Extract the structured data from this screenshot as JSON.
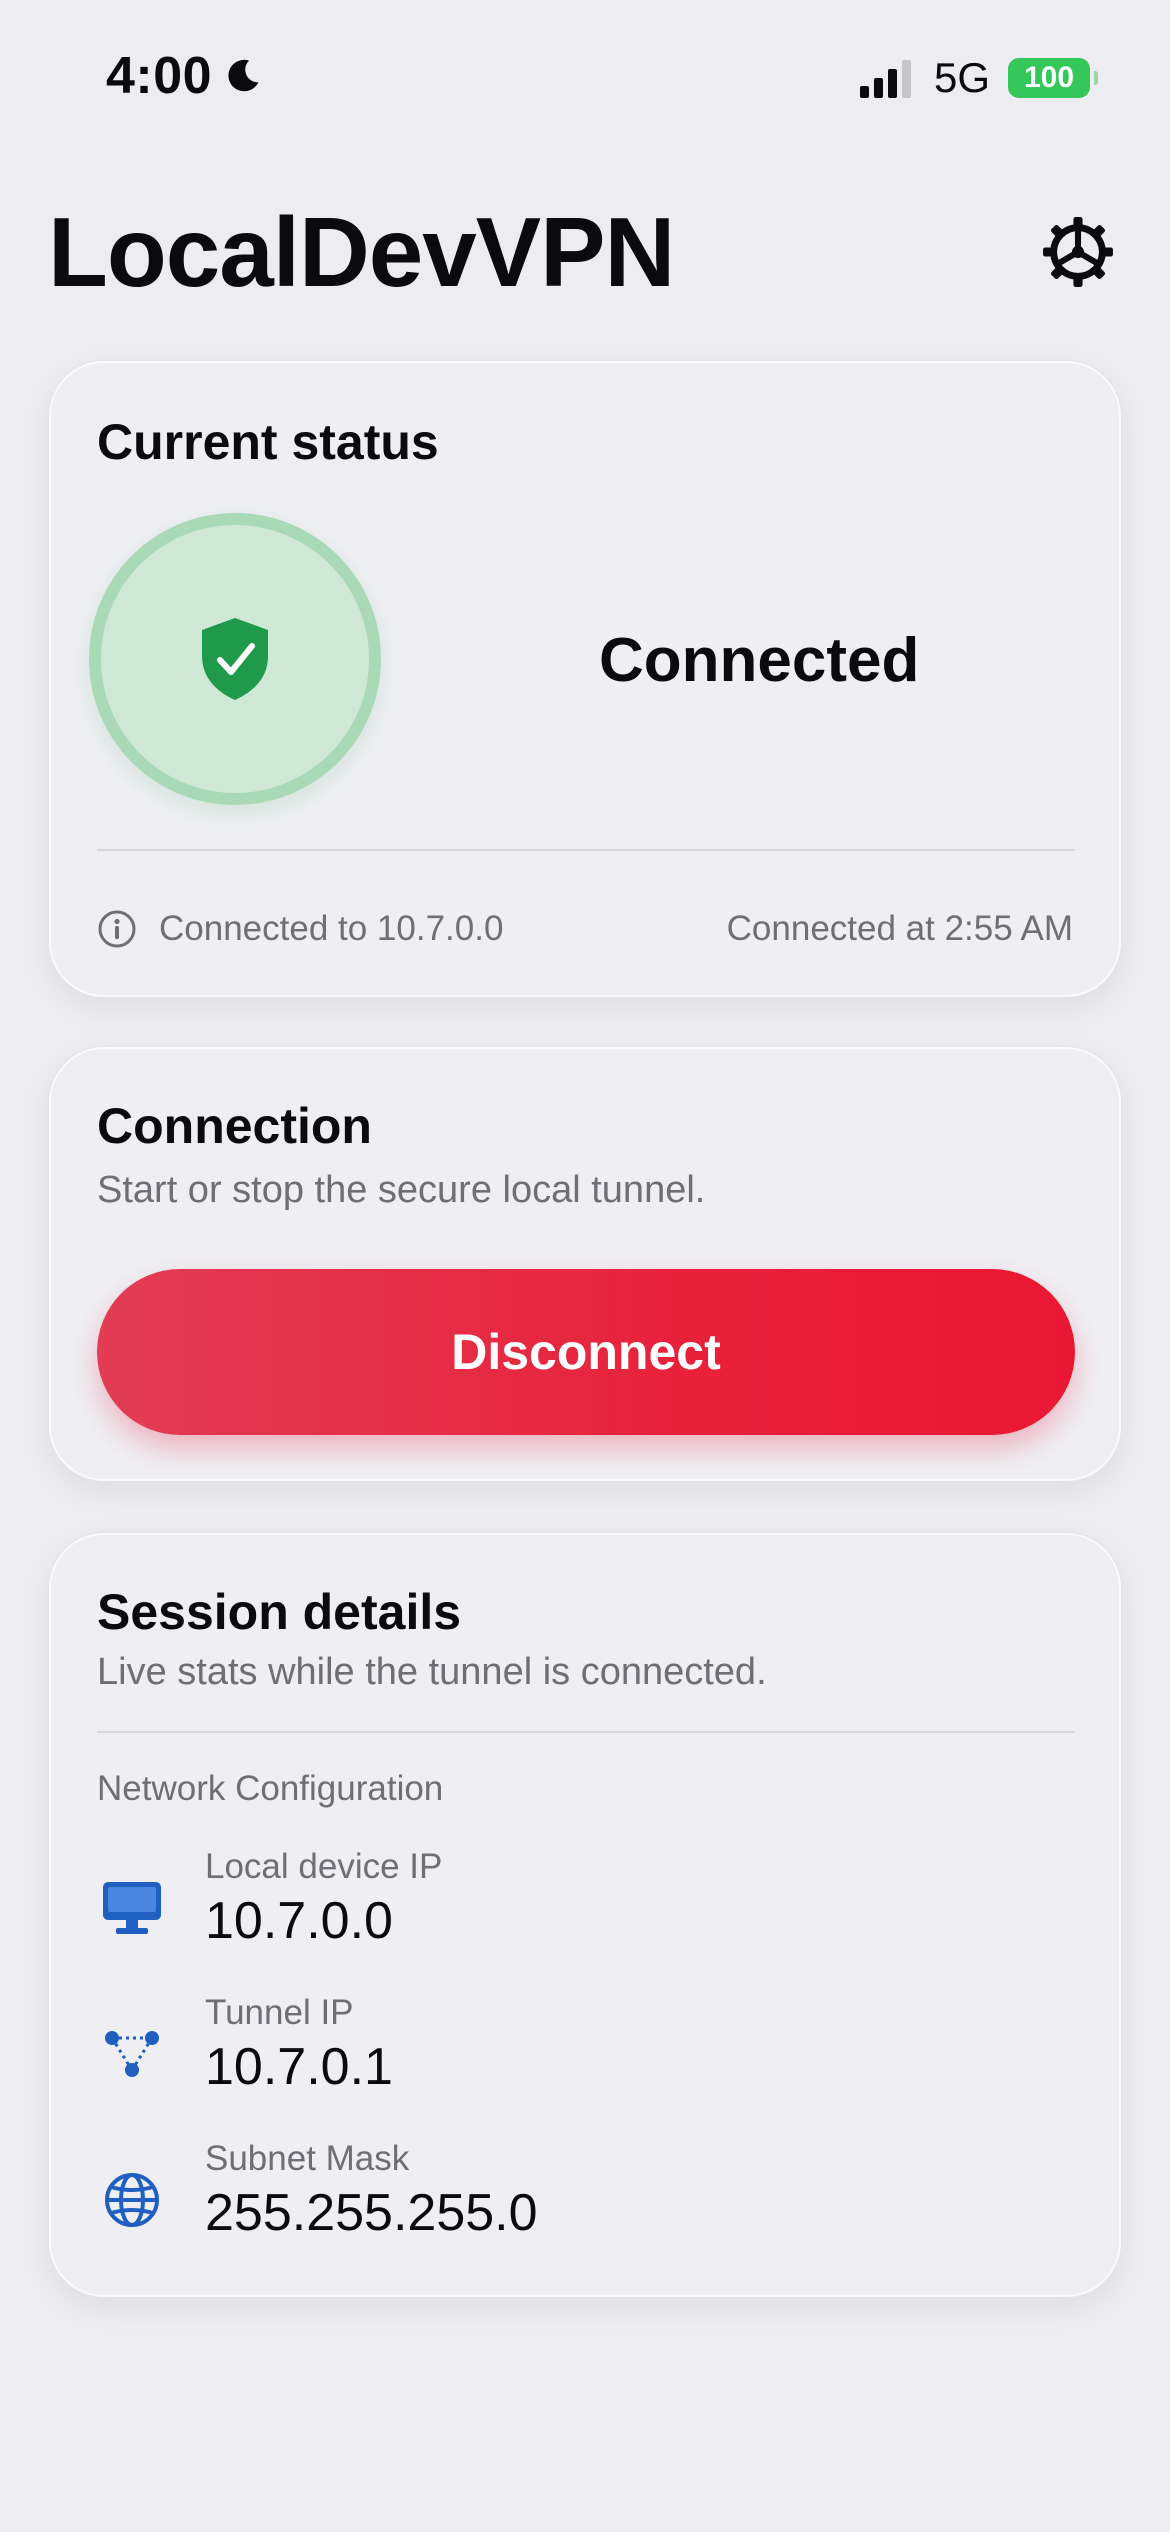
{
  "status_bar": {
    "time": "4:00",
    "network": "5G",
    "battery": "100"
  },
  "header": {
    "title": "LocalDevVPN"
  },
  "status_card": {
    "title": "Current status",
    "state": "Connected",
    "connected_to": "Connected to 10.7.0.0",
    "connected_at": "Connected at 2:55 AM",
    "accent_color": "#1e9a4a"
  },
  "connection_card": {
    "title": "Connection",
    "subtitle": "Start or stop the secure local tunnel.",
    "button_label": "Disconnect",
    "button_color": "#e8213b"
  },
  "session_card": {
    "title": "Session details",
    "subtitle": "Live stats while the tunnel is connected.",
    "section_label": "Network Configuration",
    "items": [
      {
        "icon": "desktop-computer-icon",
        "label": "Local device IP",
        "value": "10.7.0.0"
      },
      {
        "icon": "network-nodes-icon",
        "label": "Tunnel IP",
        "value": "10.7.0.1"
      },
      {
        "icon": "globe-icon",
        "label": "Subnet Mask",
        "value": "255.255.255.0"
      }
    ]
  }
}
